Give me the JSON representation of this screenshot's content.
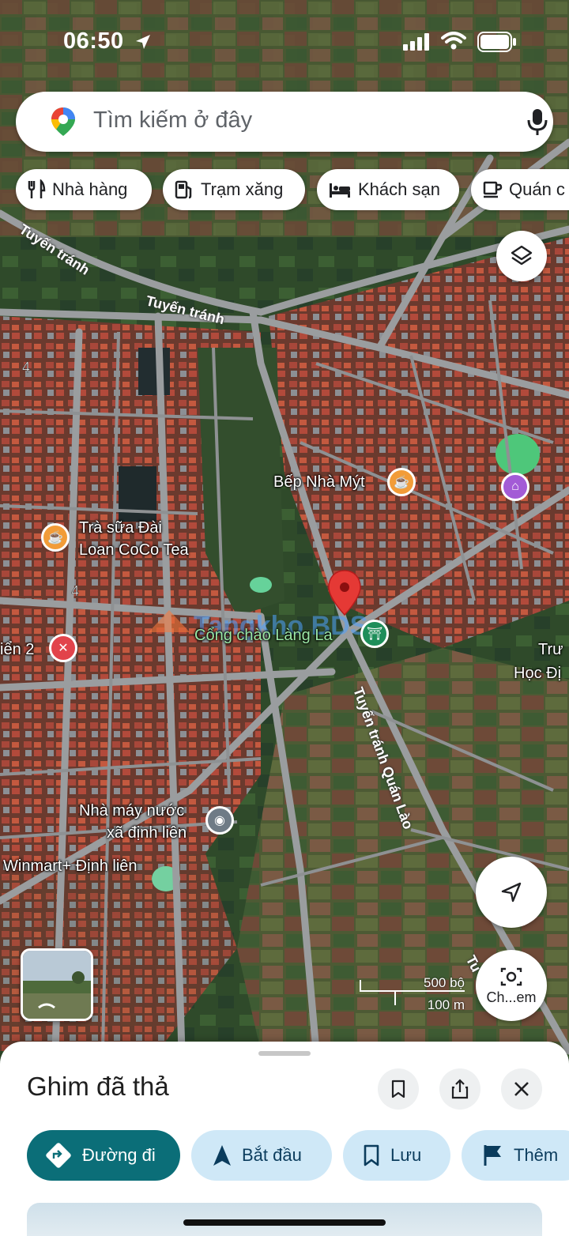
{
  "status_bar": {
    "time": "06:50"
  },
  "search": {
    "placeholder": "Tìm kiếm ở đây"
  },
  "chips": [
    {
      "label": "Nhà hàng",
      "icon": "fork-knife-icon"
    },
    {
      "label": "Trạm xăng",
      "icon": "gas-pump-icon"
    },
    {
      "label": "Khách sạn",
      "icon": "bed-icon"
    },
    {
      "label": "Quán c",
      "icon": "coffee-cup-icon"
    }
  ],
  "map": {
    "roads": [
      "Tuyến tránh",
      "Tuyến tránh",
      "Tuyến tránh Quán Lào",
      "Tu"
    ],
    "road_numbers": [
      "4",
      "4"
    ],
    "places": {
      "bep_nha_myt": "Bếp Nhà Mýt",
      "tra_sua_line1": "Trà sữa Đài",
      "tra_sua_line2": "Loan CoCo Tea",
      "cong_chao": "Cổng chào Làng La",
      "lien2": "iển 2",
      "truong_line1": "Trư",
      "truong_line2": "Học Đị",
      "nha_may_line1": "Nhà máy nước",
      "nha_may_line2": "xã định liên",
      "winmart": "Winmart+ Định liên"
    },
    "watermark": "Tangkho BDS"
  },
  "lens_button": {
    "label": "Ch...em"
  },
  "scale": {
    "imperial": "500 bộ",
    "metric": "100 m"
  },
  "sheet": {
    "title": "Ghim đã thả",
    "actions": [
      {
        "label": "Đường đi",
        "icon": "directions-icon"
      },
      {
        "label": "Bắt đầu",
        "icon": "navigation-arrow-icon"
      },
      {
        "label": "Lưu",
        "icon": "bookmark-icon"
      },
      {
        "label": "Thêm",
        "icon": "flag-icon"
      }
    ]
  },
  "colors": {
    "directions_button": "#0b6e78",
    "action_button": "#cfe8f7",
    "pin": "#e53935",
    "coffee_poi": "#f29c38",
    "shop_poi": "#a35bd6",
    "restaurant_poi": "#e2434b"
  }
}
